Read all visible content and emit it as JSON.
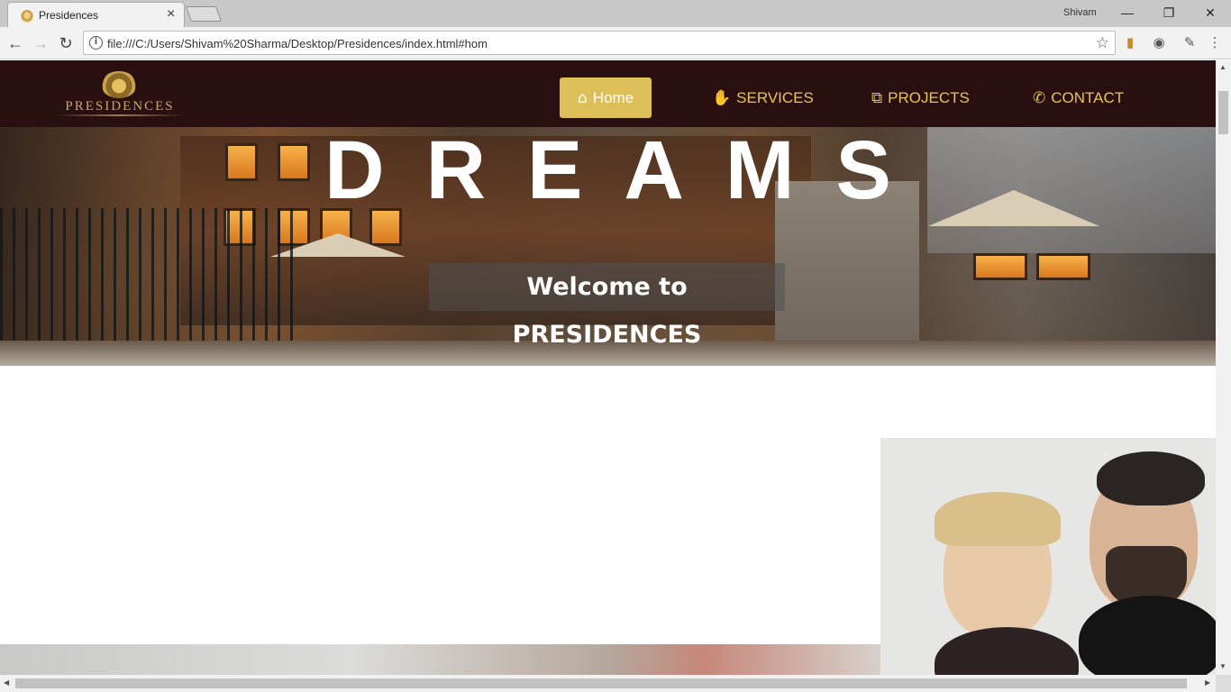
{
  "browser": {
    "tab_title": "Presidences",
    "tab_close": "×",
    "profile_name": "Shivam",
    "url": "file:///C:/Users/Shivam%20Sharma/Desktop/Presidences/index.html#hom",
    "window_controls": {
      "minimize": "—",
      "restore": "❐",
      "close": "✕"
    },
    "nav": {
      "back": "←",
      "forward": "→",
      "reload": "↻"
    },
    "icons": {
      "info": "i",
      "star": "☆",
      "extension1": "▮",
      "extension2": "◉",
      "extension3": "✎",
      "menu": "⋮"
    }
  },
  "site": {
    "logo_text": "PRESIDENCES",
    "menu": [
      {
        "label": "Home",
        "icon": "⌂",
        "active": true
      },
      {
        "label": "SERVICES",
        "icon": "✋",
        "active": false
      },
      {
        "label": "PROJECTS",
        "icon": "⧉",
        "active": false
      },
      {
        "label": "CONTACT",
        "icon": "✆",
        "active": false
      }
    ],
    "hero": {
      "title": "DREAMS",
      "caption": "Welcome to PRESIDENCES"
    }
  },
  "colors": {
    "nav_bg": "#2a0f10",
    "accent_gold": "#dcbf59",
    "menu_text": "#e6c45e"
  }
}
